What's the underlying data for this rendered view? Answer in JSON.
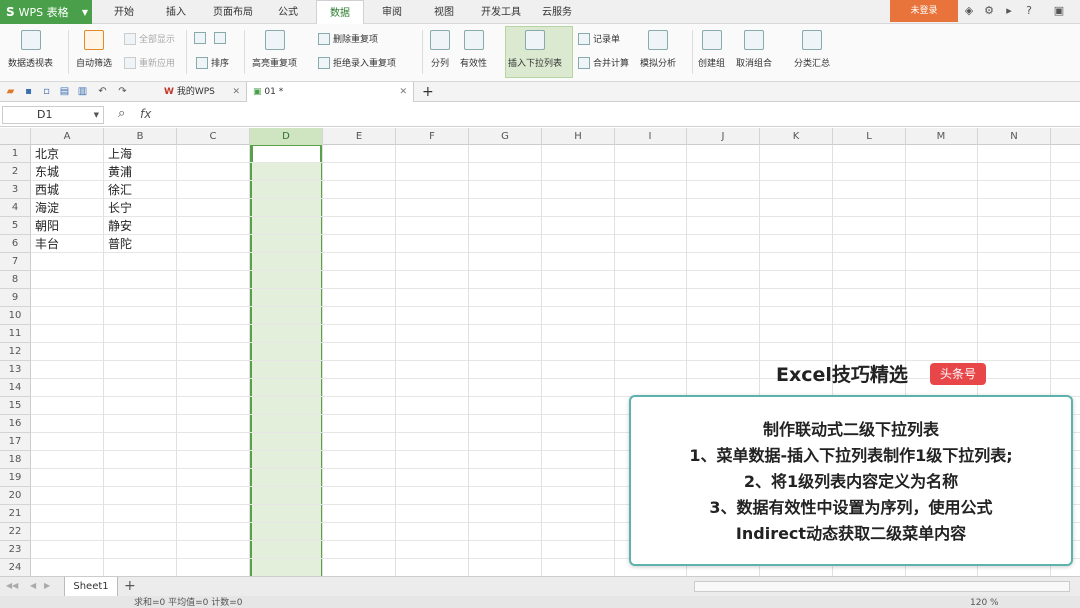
{
  "app": {
    "name": "WPS 表格",
    "login": "未登录"
  },
  "menu_tabs": [
    "开始",
    "插入",
    "页面布局",
    "公式",
    "数据",
    "审阅",
    "视图",
    "开发工具",
    "云服务"
  ],
  "active_tab": "数据",
  "ribbon": {
    "pivot": "数据透视表",
    "autofilter": "自动筛选",
    "show_all": "全部显示",
    "reapply": "重新应用",
    "sort": "排序",
    "highlight_dup": "高亮重复项",
    "remove_dup": "删除重复项",
    "reject_dup": "拒绝录入重复项",
    "split": "分列",
    "validity": "有效性",
    "insert_dropdown": "插入下拉列表",
    "record_form": "记录单",
    "consolidate": "合并计算",
    "simulation": "模拟分析",
    "group": "创建组",
    "ungroup": "取消组合",
    "subtotal": "分类汇总"
  },
  "doc_tabs": [
    {
      "label": "我的WPS"
    },
    {
      "label": "01 *"
    }
  ],
  "namebox": "D1",
  "fx_symbol": "fx",
  "columns": [
    "A",
    "B",
    "C",
    "D",
    "E",
    "F",
    "G",
    "H",
    "I",
    "J",
    "K",
    "L",
    "M",
    "N"
  ],
  "selected_column": "D",
  "rows": [
    "1",
    "2",
    "3",
    "4",
    "5",
    "6",
    "7",
    "8",
    "9",
    "10",
    "11",
    "12",
    "13",
    "14",
    "15",
    "16",
    "17",
    "18",
    "19",
    "20",
    "21",
    "22",
    "23",
    "24"
  ],
  "cells": {
    "A": [
      "北京",
      "东城",
      "西城",
      "海淀",
      "朝阳",
      "丰台"
    ],
    "B": [
      "上海",
      "黄浦",
      "徐汇",
      "长宁",
      "静安",
      "普陀"
    ]
  },
  "overlay": {
    "brand": "Excel技巧精选",
    "badge": "头条号",
    "lines": [
      "制作联动式二级下拉列表",
      "1、菜单数据-插入下拉列表制作1级下拉列表;",
      "2、将1级列表内容定义为名称",
      "3、数据有效性中设置为序列，使用公式",
      "Indirect动态获取二级菜单内容"
    ]
  },
  "sheets": [
    "Sheet1"
  ],
  "status": {
    "text": "求和=0  平均值=0  计数=0",
    "zoom": "120 %"
  },
  "colors": {
    "green": "#4aa04a",
    "login": "#e8743b",
    "selection": "#e3efdb",
    "overlay_border": "#5db2ad",
    "badge": "#e8474a"
  }
}
